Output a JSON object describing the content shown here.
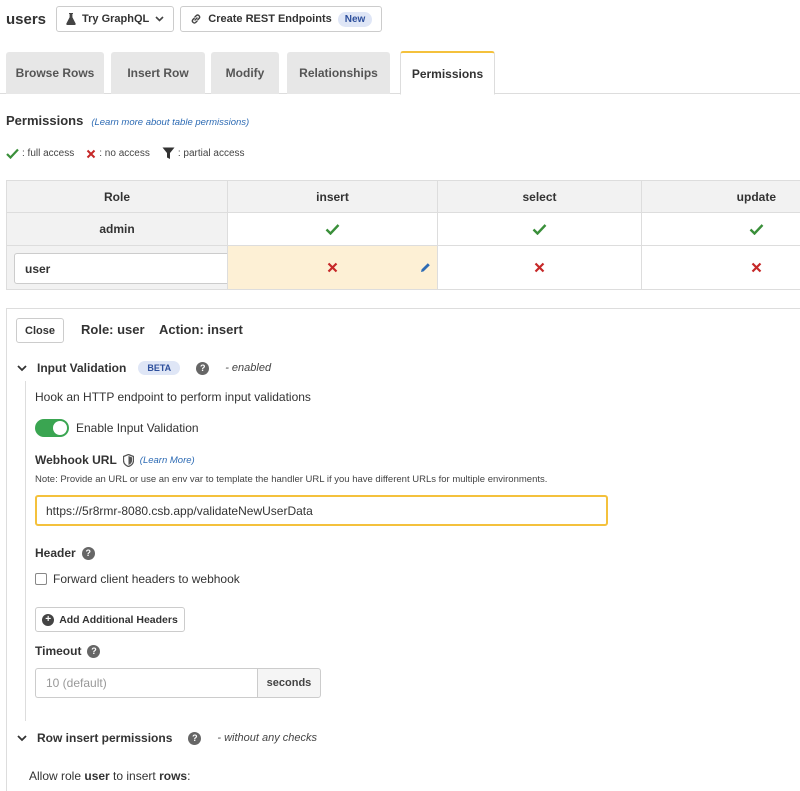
{
  "header": {
    "table_name": "users",
    "try_graphql_label": "Try GraphQL",
    "rest_label": "Create REST Endpoints",
    "new_badge": "New"
  },
  "tabs": [
    {
      "label": "Browse Rows",
      "active": false
    },
    {
      "label": "Insert Row",
      "active": false
    },
    {
      "label": "Modify",
      "active": false
    },
    {
      "label": "Relationships",
      "active": false
    },
    {
      "label": "Permissions",
      "active": true
    }
  ],
  "permissions": {
    "title": "Permissions",
    "learn_link": "(Learn more about table permissions)",
    "legend": {
      "full": ": full access",
      "none": ": no access",
      "partial": ": partial access"
    },
    "columns": [
      "Role",
      "insert",
      "select",
      "update"
    ],
    "rows": [
      {
        "role": "admin",
        "values": [
          "full",
          "full",
          "full"
        ]
      },
      {
        "role": "user",
        "values": [
          "none",
          "none",
          "none"
        ]
      }
    ]
  },
  "editor": {
    "close_label": "Close",
    "role_label": "Role: user",
    "action_label": "Action: insert",
    "input_validation": {
      "title": "Input Validation",
      "badge": "BETA",
      "status": "- enabled",
      "description": "Hook an HTTP endpoint to perform input validations",
      "toggle_label": "Enable Input Validation",
      "toggle_on": true,
      "webhook_title": "Webhook URL",
      "learn_more": "(Learn More)",
      "note": "Note: Provide an URL or use an env var to template the handler URL if you have different URLs for multiple environments.",
      "webhook_url": "https://5r8rmr-8080.csb.app/validateNewUserData",
      "header_title": "Header",
      "forward_label": "Forward client headers to webhook",
      "add_headers_label": "Add Additional Headers",
      "timeout_title": "Timeout",
      "timeout_placeholder": "10 (default)",
      "timeout_unit": "seconds"
    },
    "row_permissions": {
      "title": "Row insert permissions",
      "status": "- without any checks",
      "allow_prefix": "Allow role ",
      "allow_role": "user",
      "allow_mid": " to insert ",
      "allow_rows": "rows",
      "allow_suffix": ":"
    }
  },
  "colors": {
    "accent": "#f4c13c",
    "full": "#3a8f3a",
    "none": "#c62828",
    "toggle": "#3aa551"
  }
}
